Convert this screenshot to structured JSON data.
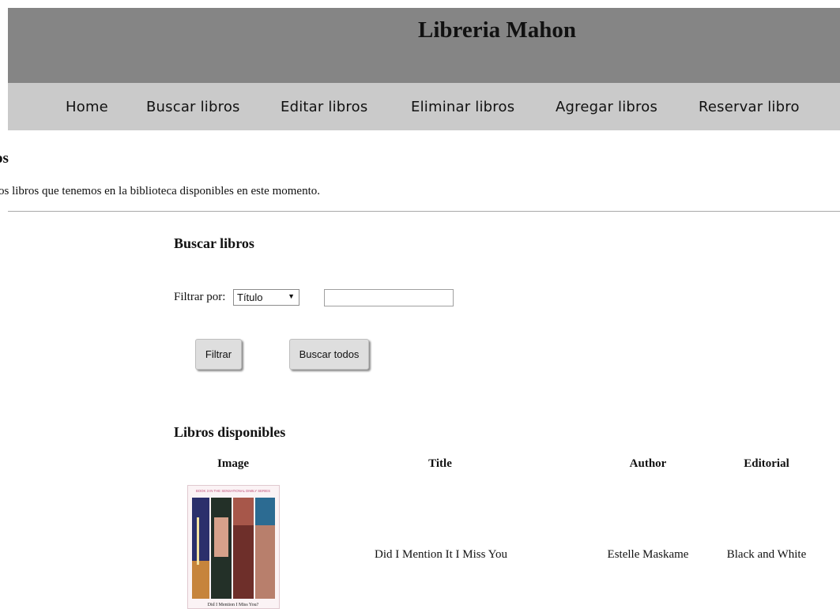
{
  "header": {
    "title": "Libreria Mahon"
  },
  "nav": {
    "items": [
      {
        "label": "Home"
      },
      {
        "label": "Buscar libros"
      },
      {
        "label": "Editar libros"
      },
      {
        "label": "Eliminar libros"
      },
      {
        "label": "Agregar libros"
      },
      {
        "label": "Reservar libro"
      }
    ]
  },
  "page": {
    "heading": "os",
    "intro": "os libros que tenemos en la biblioteca disponibles en este momento."
  },
  "search": {
    "title": "Buscar libros",
    "filter_label": "Filtrar por:",
    "filter_selected": "Título",
    "filter_value": "",
    "filter_button": "Filtrar",
    "all_button": "Buscar todos"
  },
  "results": {
    "title": "Libros disponibles",
    "columns": [
      "Image",
      "Title",
      "Author",
      "Editorial"
    ],
    "rows": [
      {
        "title": "Did I Mention It I Miss You",
        "author": "Estelle Maskame",
        "editorial": "Black and White",
        "cover": {
          "series_text": "BOOK 3 IN THE SENSATIONAL DIMILY SERIES",
          "bottom_text": "Did I Mention I Miss You?"
        }
      }
    ]
  },
  "colors": {
    "header_bg": "#858585",
    "nav_bg": "#cacaca",
    "button_bg": "#dedede"
  }
}
